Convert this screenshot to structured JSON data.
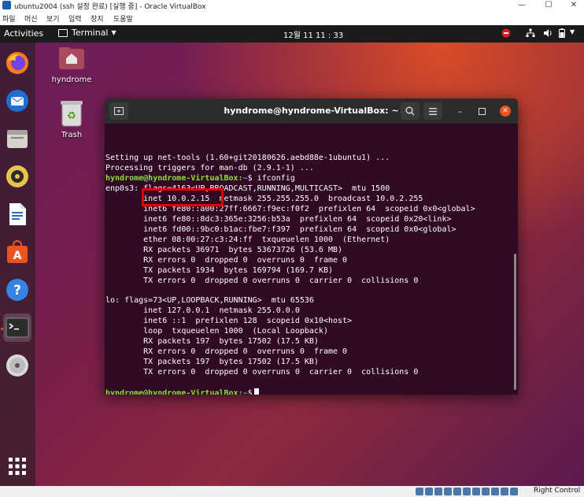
{
  "window": {
    "title": "ubuntu2004 (ssh 설정 완료) [실행 중] - Oracle VirtualBox",
    "controls": [
      "—",
      "☐",
      "✕"
    ]
  },
  "menu": [
    "파일",
    "머신",
    "보기",
    "입력",
    "장치",
    "도움말"
  ],
  "topbar": {
    "activities": "Activities",
    "app": "Terminal",
    "clock": "12월 11  11 : 33"
  },
  "desktop_icons": [
    {
      "label": "hyndrome"
    },
    {
      "label": "Trash"
    }
  ],
  "dock": [
    "firefox-icon",
    "thunderbird-icon",
    "files-icon",
    "rhythmbox-icon",
    "libreoffice-writer-icon",
    "ubuntu-software-icon",
    "help-icon",
    "terminal-icon",
    "dvd-icon",
    "show-apps-icon"
  ],
  "terminal": {
    "title": "hyndrome@hyndrome-VirtualBox: ~",
    "prompt": "hyndrome@hyndrome-VirtualBox:",
    "lines": [
      "Setting up net-tools (1.60+git20180626.aebd88e-1ubuntu1) ...",
      "Processing triggers for man-db (2.9.1-1) ...",
      "",
      "enp0s3: flags=4163<UP,BROADCAST,RUNNING,MULTICAST>  mtu 1500",
      "        inet 10.0.2.15  netmask 255.255.255.0  broadcast 10.0.2.255",
      "        inet6 fe80::a00:27ff:6667:f9ec:f0f2  prefixlen 64  scopeid 0x0<global>",
      "        inet6 fe80::8dc3:365e:3256:b53a  prefixlen 64  scopeid 0x20<link>",
      "        inet6 fd00::9bc0:b1ac:fbe7:f397  prefixlen 64  scopeid 0x0<global>",
      "        ether 08:00:27:c3:24:ff  txqueuelen 1000  (Ethernet)",
      "        RX packets 36971  bytes 53673726 (53.6 MB)",
      "        RX errors 0  dropped 0  overruns 0  frame 0",
      "        TX packets 1934  bytes 169794 (169.7 KB)",
      "        TX errors 0  dropped 0 overruns 0  carrier 0  collisions 0",
      "",
      "lo: flags=73<UP,LOOPBACK,RUNNING>  mtu 65536",
      "        inet 127.0.0.1  netmask 255.0.0.0",
      "        inet6 ::1  prefixlen 128  scopeid 0x10<host>",
      "        loop  txqueuelen 1000  (Local Loopback)",
      "        RX packets 197  bytes 17502 (17.5 KB)",
      "        RX errors 0  dropped 0  overruns 0  frame 0",
      "        TX packets 197  bytes 17502 (17.5 KB)",
      "        TX errors 0  dropped 0 overruns 0  carrier 0  collisions 0",
      "",
      ""
    ],
    "cmd_line": {
      "path": "~",
      "cmd": "$ ifconfig"
    },
    "final_line": {
      "path": "~",
      "cmd": "$"
    }
  },
  "status": {
    "host_key": "Right Control"
  },
  "colors": {
    "prompt": "#8ae234",
    "terminal_bg": "#300a24",
    "highlight": "#e00000",
    "accent": "#e95420"
  }
}
